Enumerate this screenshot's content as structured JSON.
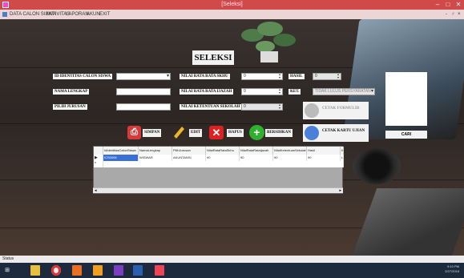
{
  "window": {
    "title": "[Seleksi]",
    "controls": [
      "–",
      "□",
      "✕"
    ],
    "menu_controls": [
      "-",
      "♂",
      "×"
    ]
  },
  "menu": [
    "DATA CALON SISWA",
    "AKTIVITAS",
    "LAPORAN",
    "AKUN",
    "EXIT"
  ],
  "form": {
    "heading": "SELEKSI",
    "labels": {
      "id": "ID IDENTITAS CALON SISWA",
      "nama": "NAMA LENGKAP",
      "jurusan": "PILIH JURUSAN",
      "skhu": "NILAI RATA RATA SKHU",
      "ijazah": "NILAI RATA RATA IJAZAH",
      "ketentuan": "NILAI KETENTUAN SEKOLAH",
      "hasil": "HASIL",
      "ket": "KET."
    },
    "values": {
      "id": "",
      "nama": "",
      "jurusan": "",
      "skhu": "0",
      "ijazah": "0",
      "ketentuan": "0",
      "hasil": "0",
      "ket": "TIDAK LULUS PERSYARATAN"
    }
  },
  "buttons": {
    "simpan": "SIMPAN",
    "edit": "EDIT",
    "hapus": "HAPUS",
    "bersihkan": "BERSIHKAN",
    "cetak_formulir": "CETAK FORMULIR",
    "cetak_kartu": "CETAK KARTU UJIAN",
    "cari": "CARI"
  },
  "grid": {
    "columns": [
      "IdIdentitasCalonSiswa",
      "NamaLengkap",
      "PilihJurusan",
      "NilaiRataRataSkhu",
      "NilaiRataRataIjazah",
      "NilaiKetentuanSekolah",
      "Hasil",
      "Ke"
    ],
    "rows": [
      [
        "ICS0006",
        "WISWAR",
        "AKUNTANSI",
        "90",
        "90",
        "90",
        "90",
        "LU"
      ]
    ]
  },
  "status": "Status",
  "taskbar": {
    "apps": [
      "start",
      "explorer",
      "chrome",
      "app-orange",
      "media",
      "visual-studio",
      "word",
      "paint"
    ],
    "clock_time": "9:10 PM",
    "clock_date": "2/27/2018"
  },
  "colors": {
    "titlebar": "#d04a4a",
    "selected_row": "#3a6fd8",
    "taskbar": "#1d2a3d"
  }
}
